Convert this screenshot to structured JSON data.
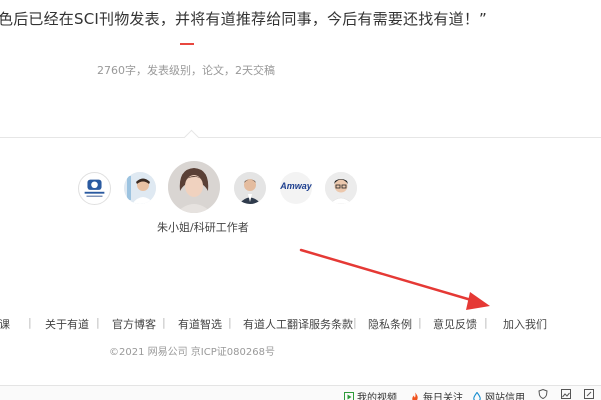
{
  "testimonial": {
    "quote": "色后已经在SCI刊物发表，并将有道推荐给同事，今后有需要还找有道！”",
    "meta": "2760字，发表级别，论文，2天交稿"
  },
  "customers": {
    "logo_text": "Amway",
    "selected_caption": "朱小姐/科研工作者"
  },
  "footer": {
    "links": [
      "课",
      "关于有道",
      "官方博客",
      "有道智选",
      "有道人工翻译服务条款",
      "隐私条例",
      "意见反馈",
      "加入我们"
    ],
    "separator": "|",
    "copyright": "©2021 网易公司 京ICP证080268号"
  },
  "bottom_bar": {
    "items": [
      "我的视频",
      "每日关注",
      "网站信用"
    ]
  },
  "colors": {
    "accent": "#e8473f",
    "arrow": "#e53935"
  }
}
